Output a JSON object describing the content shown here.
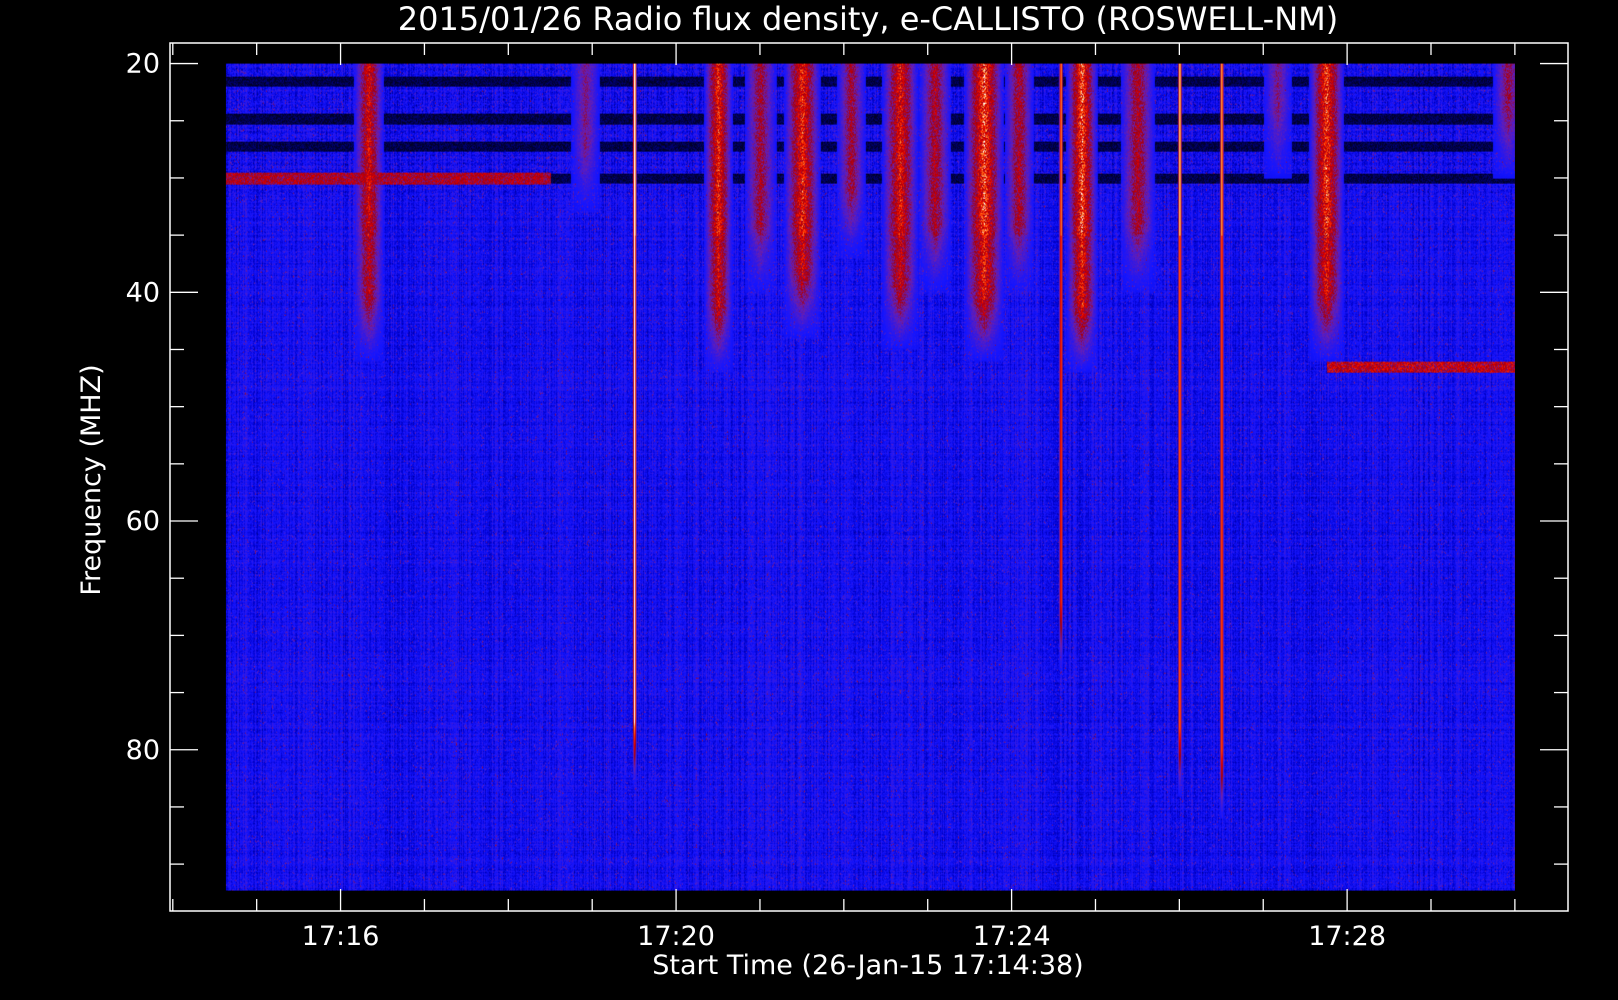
{
  "chart_data": {
    "type": "heatmap",
    "title": "2015/01/26  Radio flux density, e-CALLISTO (ROSWELL-NM)",
    "xlabel": "Start Time (26-Jan-15 17:14:38)",
    "ylabel": "Frequency (MHZ)",
    "x_axis": {
      "unit": "time",
      "range": [
        "17:14:38",
        "17:30:00"
      ],
      "axis_range": [
        "17:13:58",
        "17:30:38"
      ],
      "major_ticks": [
        "17:16",
        "17:20",
        "17:24",
        "17:28"
      ],
      "minor_tick_interval_s": 60
    },
    "y_axis": {
      "unit": "MHz",
      "inverted": true,
      "data_range": [
        20,
        92.3
      ],
      "axis_range": [
        18.2,
        94.1
      ],
      "major_ticks": [
        20,
        40,
        60,
        80
      ],
      "minor_tick_interval": 5
    },
    "colormap": [
      "#000000",
      "#000033",
      "#0000cc",
      "#1515ff",
      "#6a1fb0",
      "#a00010",
      "#e00000",
      "#ff3a00",
      "#ff9a40",
      "#ffffff"
    ],
    "background_color": "#1e1edc",
    "interference_bands_mhz": [
      {
        "freq": 21.5,
        "level": "low"
      },
      {
        "freq": 24.8,
        "level": "low"
      },
      {
        "freq": 27.2,
        "level": "low"
      },
      {
        "freq": 30.0,
        "level": "low"
      }
    ],
    "broadband_bursts": [
      {
        "time": "17:16:20",
        "f_min": 20,
        "f_max": 46,
        "intensity": 0.75
      },
      {
        "time": "17:18:55",
        "f_min": 20,
        "f_max": 33,
        "intensity": 0.4
      },
      {
        "time": "17:19:30",
        "f_min": 20,
        "f_max": 83,
        "intensity": 0.95,
        "narrow": true
      },
      {
        "time": "17:20:30",
        "f_min": 20,
        "f_max": 47,
        "intensity": 0.85
      },
      {
        "time": "17:21:00",
        "f_min": 20,
        "f_max": 40,
        "intensity": 0.55
      },
      {
        "time": "17:21:30",
        "f_min": 20,
        "f_max": 44,
        "intensity": 0.85
      },
      {
        "time": "17:22:05",
        "f_min": 20,
        "f_max": 37,
        "intensity": 0.55
      },
      {
        "time": "17:22:40",
        "f_min": 20,
        "f_max": 45,
        "intensity": 0.8
      },
      {
        "time": "17:23:05",
        "f_min": 20,
        "f_max": 40,
        "intensity": 0.6
      },
      {
        "time": "17:23:40",
        "f_min": 20,
        "f_max": 46,
        "intensity": 0.95
      },
      {
        "time": "17:24:05",
        "f_min": 20,
        "f_max": 40,
        "intensity": 0.6
      },
      {
        "time": "17:24:35",
        "f_min": 20,
        "f_max": 73,
        "intensity": 0.7,
        "narrow": true
      },
      {
        "time": "17:24:50",
        "f_min": 20,
        "f_max": 47,
        "intensity": 0.95
      },
      {
        "time": "17:25:30",
        "f_min": 20,
        "f_max": 40,
        "intensity": 0.6
      },
      {
        "time": "17:26:00",
        "f_min": 20,
        "f_max": 84,
        "intensity": 0.8,
        "narrow": true
      },
      {
        "time": "17:26:30",
        "f_min": 20,
        "f_max": 86,
        "intensity": 0.75,
        "narrow": true
      },
      {
        "time": "17:27:10",
        "f_min": 20,
        "f_max": 30,
        "intensity": 0.4
      },
      {
        "time": "17:27:45",
        "f_min": 20,
        "f_max": 46,
        "intensity": 0.9
      },
      {
        "time": "17:29:55",
        "f_min": 20,
        "f_max": 30,
        "intensity": 0.5
      }
    ],
    "narrowband_features": [
      {
        "t_start": "17:27:45",
        "t_end": "17:30:00",
        "freq": 46.5,
        "intensity": 0.9
      },
      {
        "t_start": "17:14:38",
        "t_end": "17:18:30",
        "freq": 30.0,
        "intensity": 0.7
      }
    ]
  }
}
